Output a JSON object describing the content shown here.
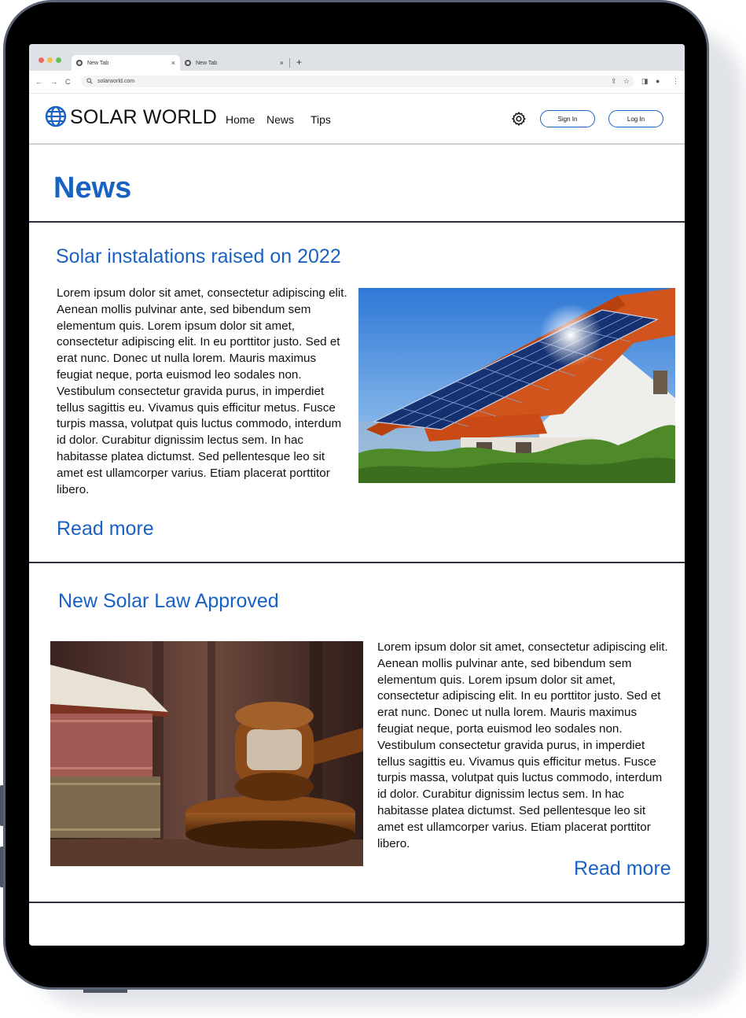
{
  "browser": {
    "tabs": [
      {
        "label": "New Tab",
        "close": "×"
      },
      {
        "label": "New Tab",
        "close": "×"
      }
    ],
    "new_tab": "+",
    "url": "solarworld.com",
    "nav": {
      "back": "←",
      "forward": "→",
      "reload": "C"
    },
    "tools": {
      "share": "⇪",
      "star": "☆",
      "sidebar": "◨",
      "profile": "●",
      "menu": "⋮"
    }
  },
  "site": {
    "logo": "SOLAR WORLD",
    "nav": [
      "Home",
      "News",
      "Tips"
    ],
    "sign_in": "Sign In",
    "log_in": "Log In"
  },
  "page": {
    "title": "News"
  },
  "articles": [
    {
      "title": "Solar instalations raised on 2022",
      "body": "Lorem ipsum dolor sit amet, consectetur adipiscing elit. Aenean mollis pulvinar ante, sed bibendum sem elementum quis. Lorem ipsum dolor sit amet, consectetur adipiscing elit. In eu porttitor justo. Sed et erat nunc. Donec ut nulla lorem. Mauris maximus feugiat neque, porta euismod leo sodales non. Vestibulum consectetur gravida purus, in imperdiet tellus sagittis eu. Vivamus quis efficitur metus. Fusce turpis massa, volutpat quis luctus commodo, interdum id dolor. Curabitur dignissim lectus sem. In hac habitasse platea dictumst. Sed pellentesque leo sit amet est ullamcorper varius. Etiam placerat porttitor libero.",
      "read_more": "Read more"
    },
    {
      "title": "New Solar Law Approved",
      "body": "Lorem ipsum dolor sit amet, consectetur adipiscing elit. Aenean mollis pulvinar ante, sed bibendum sem elementum quis. Lorem ipsum dolor sit amet, consectetur adipiscing elit. In eu porttitor justo. Sed et erat nunc. Donec ut nulla lorem. Mauris maximus feugiat neque, porta euismod leo sodales non. Vestibulum consectetur gravida purus, in imperdiet tellus sagittis eu. Vivamus quis efficitur metus. Fusce turpis massa, volutpat quis luctus commodo, interdum id dolor. Curabitur dignissim lectus sem. In hac habitasse platea dictumst. Sed pellentesque leo sit amet est ullamcorper varius. Etiam placerat porttitor libero.",
      "read_more": "Read more"
    }
  ],
  "colors": {
    "accent": "#1a62c2",
    "frame": "#000000",
    "divider": "#2a3040"
  },
  "icons": [
    "globe-icon",
    "gear-icon",
    "search-icon"
  ]
}
